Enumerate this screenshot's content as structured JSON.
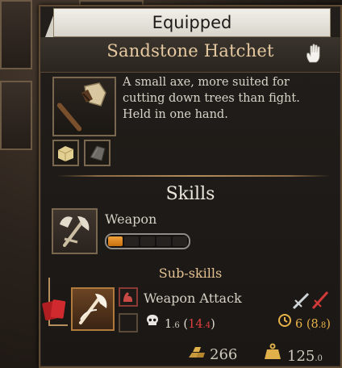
{
  "header": {
    "title": "Equipped"
  },
  "item": {
    "name": "Sandstone Hatchet",
    "description": "A small axe, more suited for cutting down trees than fight. Held in one hand."
  },
  "skills": {
    "title": "Skills",
    "weapon_label": "Weapon",
    "progress": {
      "filled_segments": 1,
      "total_segments": 5
    },
    "subskills_title": "Sub-skills",
    "attack_label": "Weapon Attack",
    "skull_stat": {
      "base": "1",
      "base_decimal": ".6",
      "open": " (",
      "crit": "14",
      "crit_decimal": ".4",
      "close": ")"
    },
    "time_stat": {
      "base": "6",
      "open": " (",
      "alt": "8",
      "alt_decimal": ".8",
      "close": ")"
    }
  },
  "footer": {
    "value": "266",
    "weight": "125",
    "weight_decimal": ".0"
  },
  "colors": {
    "accent_gold": "#e6c9a1",
    "progress_fill": "#e8952a",
    "crit_red": "#e04040",
    "time_gold": "#e8b24a"
  },
  "icons": [
    "hand-cursor-icon",
    "hatchet-icon",
    "sandstone-block-icon",
    "stone-slab-icon",
    "weapon-skill-icon",
    "weapon-attack-icon",
    "muscle-icon",
    "skull-icon",
    "clock-icon",
    "cards-icon",
    "swords-icon",
    "gold-bars-icon",
    "weight-icon"
  ]
}
